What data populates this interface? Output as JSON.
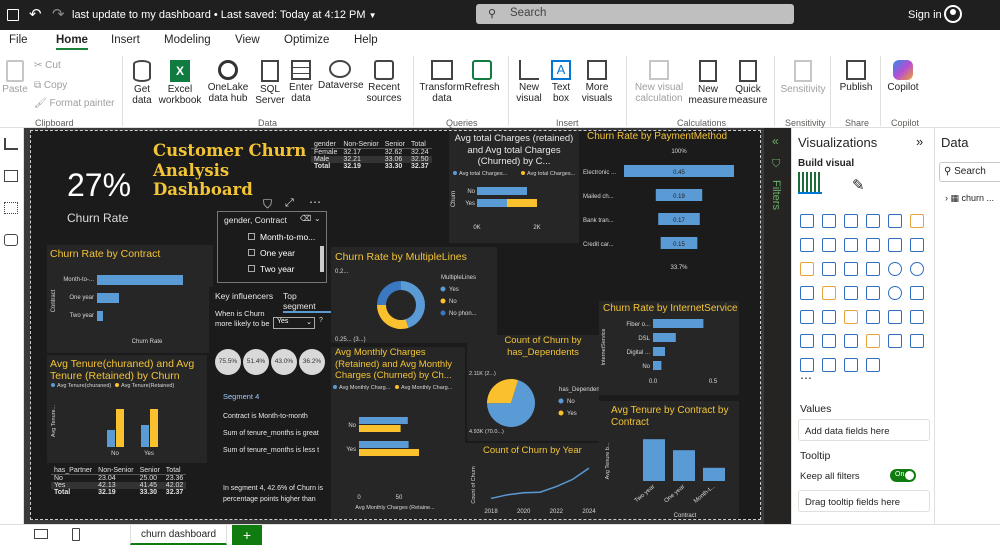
{
  "titlebar": {
    "title": "last update to my dashboard",
    "saved": "Last saved: Today at 4:12 PM",
    "search_placeholder": "Search",
    "signin": "Sign in"
  },
  "menu": [
    "File",
    "Home",
    "Insert",
    "Modeling",
    "View",
    "Optimize",
    "Help"
  ],
  "ribbon": {
    "clipboard": {
      "paste": "Paste",
      "cut": "Cut",
      "copy": "Copy",
      "format_painter": "Format painter",
      "group": "Clipboard"
    },
    "data": {
      "get_data": "Get data",
      "excel": "Excel workbook",
      "onelake": "OneLake data hub",
      "sql": "SQL Server",
      "enter": "Enter data",
      "dataverse": "Dataverse",
      "recent": "Recent sources",
      "group": "Data"
    },
    "queries": {
      "transform": "Transform data",
      "refresh": "Refresh",
      "group": "Queries"
    },
    "insert": {
      "new_visual": "New visual",
      "text_box": "Text box",
      "more_visuals": "More visuals",
      "group": "Insert"
    },
    "calculations": {
      "new_calc": "New visual calculation",
      "new_measure": "New measure",
      "quick_measure": "Quick measure",
      "group": "Calculations"
    },
    "sensitivity": {
      "label": "Sensitivity",
      "group": "Sensitivity"
    },
    "share": {
      "publish": "Publish",
      "group": "Share"
    },
    "copilot": {
      "label": "Copilot",
      "group": "Copilot"
    }
  },
  "dashboard": {
    "kpi": {
      "value": "27%",
      "label": "Churn Rate"
    },
    "title": "Customer Churn Analysis Dashboard",
    "gender_table": {
      "headers": [
        "gender",
        "Non-Senior",
        "Senior",
        "Total"
      ],
      "rows": [
        [
          "Female",
          "32.17",
          "32.62",
          "32.24"
        ],
        [
          "Male",
          "32.21",
          "33.06",
          "32.50"
        ],
        [
          "Total",
          "32.19",
          "33.30",
          "32.37"
        ]
      ]
    },
    "slicer": {
      "title": "gender, Contract",
      "items": [
        "Month-to-mo...",
        "One year",
        "Two year"
      ]
    },
    "contract_chart": {
      "title": "Churn Rate by Contract"
    },
    "key_influencers": {
      "tab1": "Key influencers",
      "tab2": "Top segment",
      "question": "When is Churn more likely to be",
      "select": "Yes",
      "bubbles": [
        "75.5%",
        "51.4%",
        "43.0%",
        "36.2%"
      ],
      "segment": "Segment 4",
      "lines": [
        "Contract is Month-to-month",
        "Sum of tenure_months is great",
        "Sum of tenure_months is less t"
      ],
      "footer": "In segment 4, 42.6% of Churn is percentage points higher than"
    },
    "tenure_churn": {
      "title": "Avg Tenure(churaned) and Avg Tenure (Retained) by Churn"
    },
    "partner_table": {
      "headers": [
        "has_Partner",
        "Non-Senior",
        "Senior",
        "Total"
      ],
      "rows": [
        [
          "No",
          "23.04",
          "25.00",
          "23.36"
        ],
        [
          "Yes",
          "42.13",
          "41.45",
          "42.02"
        ],
        [
          "Total",
          "32.19",
          "33.30",
          "32.37"
        ]
      ]
    },
    "multiplelines": {
      "title": "Churn Rate by MultipleLines"
    },
    "monthly_charges": {
      "title": "Avg Monthly Charges (Retained) and Avg Monthly Charges (Churned) by Ch..."
    },
    "total_charges": {
      "title": "Avg total Charges (retained) and Avg total Charges (Churned) by C..."
    },
    "dependents": {
      "title": "Count of Churn by has_Dependents"
    },
    "churn_year": {
      "title": "Count of Churn by Year"
    },
    "payment": {
      "title": "Churn Rate by PaymentMethod"
    },
    "internet": {
      "title": "Churn Rate by InternetService"
    },
    "tenure_contract": {
      "title": "Avg Tenure by Contract by Contract"
    }
  },
  "chart_data": [
    {
      "type": "bar",
      "title": "Churn Rate by Contract",
      "categories": [
        "Month-to-...",
        "One year",
        "Two year"
      ],
      "values": [
        0.43,
        0.11,
        0.03
      ],
      "xlabel": "Churn Rate",
      "ylabel": "Contract"
    },
    {
      "type": "pie",
      "title": "Churn Rate by MultipleLines",
      "series": [
        {
          "name": "Yes",
          "values": [
            0.45
          ]
        },
        {
          "name": "No",
          "values": [
            0.3
          ]
        },
        {
          "name": "No phon...",
          "values": [
            0.25
          ]
        }
      ],
      "labels": [
        "0.2...",
        "0.25... (3...)"
      ],
      "legend_title": "MultipleLines"
    },
    {
      "type": "bar",
      "title": "Avg total Charges (retained) and Avg total Charges (Churned) by C...",
      "categories": [
        "No",
        "Yes"
      ],
      "series": [
        {
          "name": "Avg total Charges...",
          "values": [
            2500,
            1500
          ]
        },
        {
          "name": "Avg total Charges...",
          "values": [
            0,
            1500
          ]
        }
      ],
      "ticks": [
        "0K",
        "2K"
      ],
      "ylabel": "Churn"
    },
    {
      "type": "bar",
      "title": "Churn Rate by PaymentMethod",
      "categories": [
        "Electronic ...",
        "Mailed ch...",
        "Bank tran...",
        "Credit car..."
      ],
      "values": [
        0.45,
        0.19,
        0.17,
        0.15
      ],
      "top_label": "100%",
      "bottom_label": "33.7%"
    },
    {
      "type": "bar",
      "title": "Churn Rate by InternetService",
      "categories": [
        "Fiber o...",
        "DSL",
        "Digital ...",
        "No"
      ],
      "values": [
        0.42,
        0.19,
        0.1,
        0.07
      ],
      "ticks": [
        "0.0",
        "0.5"
      ],
      "ylabel": "InternetService"
    },
    {
      "type": "bar",
      "title": "Avg Monthly Charges (Retained) and Avg Monthly Charges (Churned) by Ch...",
      "categories": [
        "No",
        "Yes"
      ],
      "series": [
        {
          "name": "Avg Monthly Charg...",
          "values": [
            61,
            62
          ]
        },
        {
          "name": "Avg Monthly Charg...",
          "values": [
            52,
            75
          ]
        }
      ],
      "ticks": [
        "0",
        "50"
      ],
      "xlabel": "Avg Monthly Charges (Retaine..."
    },
    {
      "type": "pie",
      "title": "Count of Churn by has_Dependents",
      "series": [
        {
          "name": "No",
          "values": [
            4930
          ]
        },
        {
          "name": "Yes",
          "values": [
            2110
          ]
        }
      ],
      "labels": [
        "2.11K (2...)",
        "4.93K (70.0...)"
      ],
      "legend_title": "has_Dependents"
    },
    {
      "type": "bar",
      "title": "Avg Tenure(churaned) and Avg Tenure (Retained) by Churn",
      "categories": [
        "No",
        "Yes"
      ],
      "series": [
        {
          "name": "Avg Tenure(churaned)",
          "values": [
            17,
            22
          ]
        },
        {
          "name": "Avg Tenure(Retained)",
          "values": [
            38,
            38
          ]
        }
      ],
      "ylabel": "Avg Tenure..."
    },
    {
      "type": "line",
      "title": "Count of Churn by Year",
      "x": [
        2018,
        2019,
        2020,
        2021,
        2022,
        2023,
        2024
      ],
      "values": [
        50,
        120,
        160,
        170,
        280,
        420,
        640
      ],
      "ticks": [
        "2018",
        "2020",
        "2022",
        "2024"
      ],
      "ylabel": "Count of Churn"
    },
    {
      "type": "bar",
      "title": "Avg Tenure by Contract by Contract",
      "categories": [
        "Two year",
        "One year",
        "Month-t..."
      ],
      "values": [
        57,
        42,
        18
      ],
      "xlabel": "Contract",
      "ylabel": "Avg Tenure b..."
    }
  ],
  "visualizations": {
    "title": "Visualizations",
    "build": "Build visual",
    "values": "Values",
    "add_fields": "Add data fields here",
    "tooltip": "Tooltip",
    "keep_filters": "Keep all filters",
    "toggle": "On",
    "drag_tooltip": "Drag tooltip fields here"
  },
  "data_panel": {
    "title": "Data",
    "search": "Search",
    "item": "churn ..."
  },
  "filters": {
    "label": "Filters"
  },
  "bottom": {
    "tab": "churn dashboard",
    "add": "+"
  },
  "colors": {
    "accent": "#f3c436",
    "blue": "#5b9bd5",
    "yellow": "#fbc02d",
    "toggle": "#107c10"
  }
}
